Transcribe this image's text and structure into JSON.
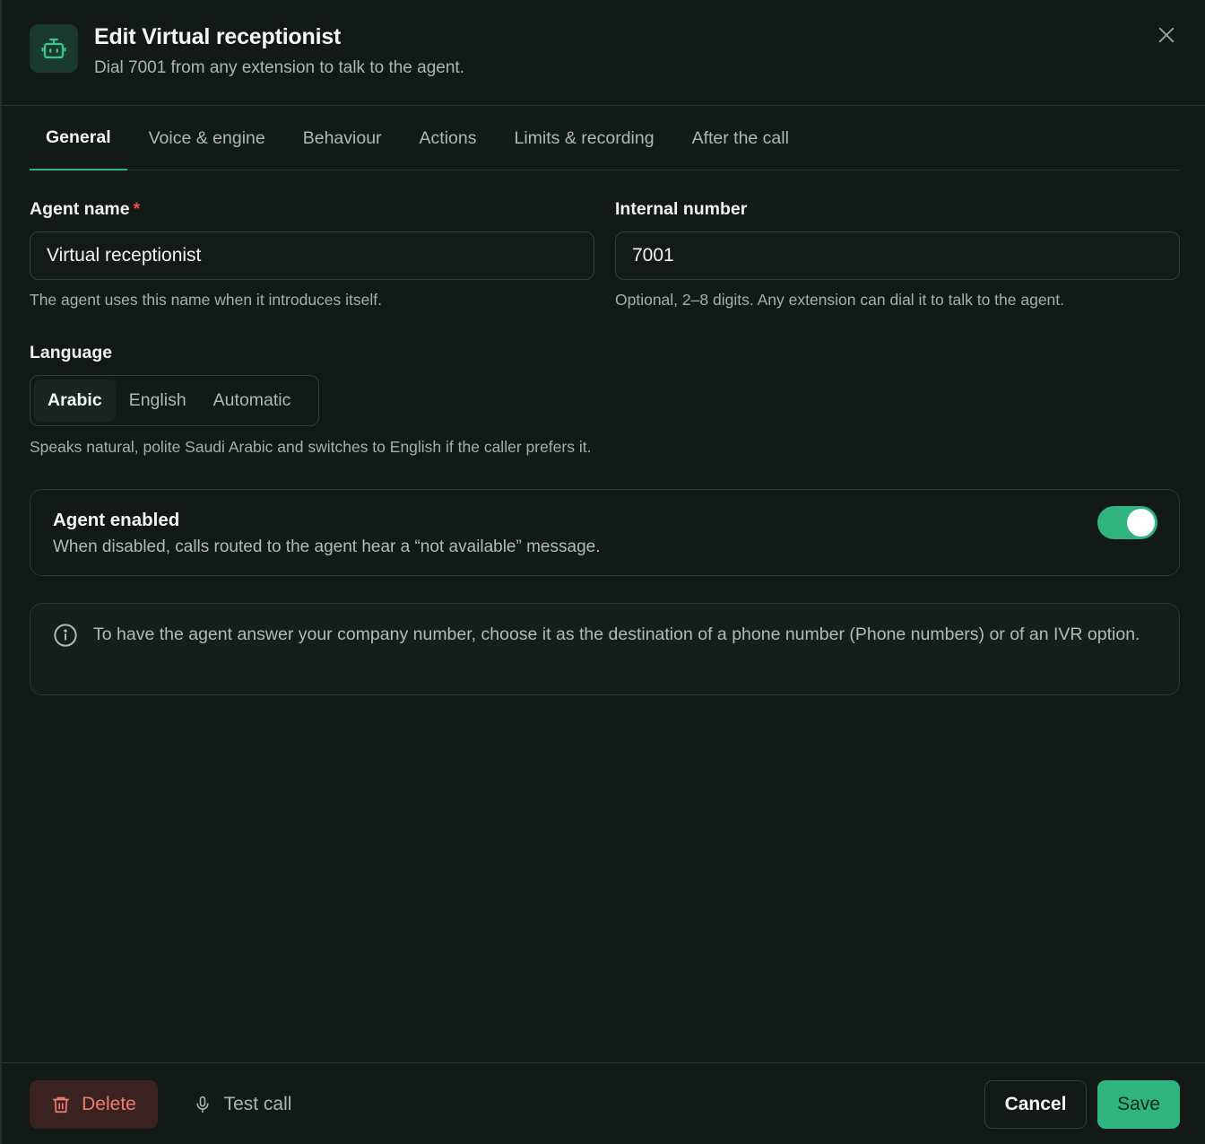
{
  "header": {
    "title": "Edit Virtual receptionist",
    "subtitle": "Dial 7001 from any extension to talk to the agent.",
    "icon": "robot-icon",
    "close_icon": "close-icon"
  },
  "tabs": [
    {
      "label": "General",
      "active": true
    },
    {
      "label": "Voice & engine"
    },
    {
      "label": "Behaviour"
    },
    {
      "label": "Actions"
    },
    {
      "label": "Limits & recording"
    },
    {
      "label": "After the call"
    }
  ],
  "form": {
    "agent_name": {
      "label": "Agent name",
      "required_mark": "*",
      "value": "Virtual receptionist",
      "help": "The agent uses this name when it introduces itself."
    },
    "internal_number": {
      "label": "Internal number",
      "value": "7001",
      "help": "Optional, 2–8 digits. Any extension can dial it to talk to the agent."
    },
    "language": {
      "label": "Language",
      "options": [
        "Arabic",
        "English",
        "Automatic"
      ],
      "selected": "Arabic",
      "help": "Speaks natural, polite Saudi Arabic and switches to English if the caller prefers it."
    }
  },
  "agent_enabled": {
    "title": "Agent enabled",
    "description": "When disabled, calls routed to the agent hear a “not available” message.",
    "enabled": true
  },
  "info": {
    "icon": "info-icon",
    "text": "To have the agent answer your company number, choose it as the destination of a phone number (Phone numbers) or of an IVR option."
  },
  "footer": {
    "delete_label": "Delete",
    "test_call_label": "Test call",
    "cancel_label": "Cancel",
    "save_label": "Save"
  },
  "colors": {
    "background": "#121917",
    "accent": "#2fb47f",
    "danger": "#ef7b6f",
    "danger_bg": "#3a2220"
  }
}
